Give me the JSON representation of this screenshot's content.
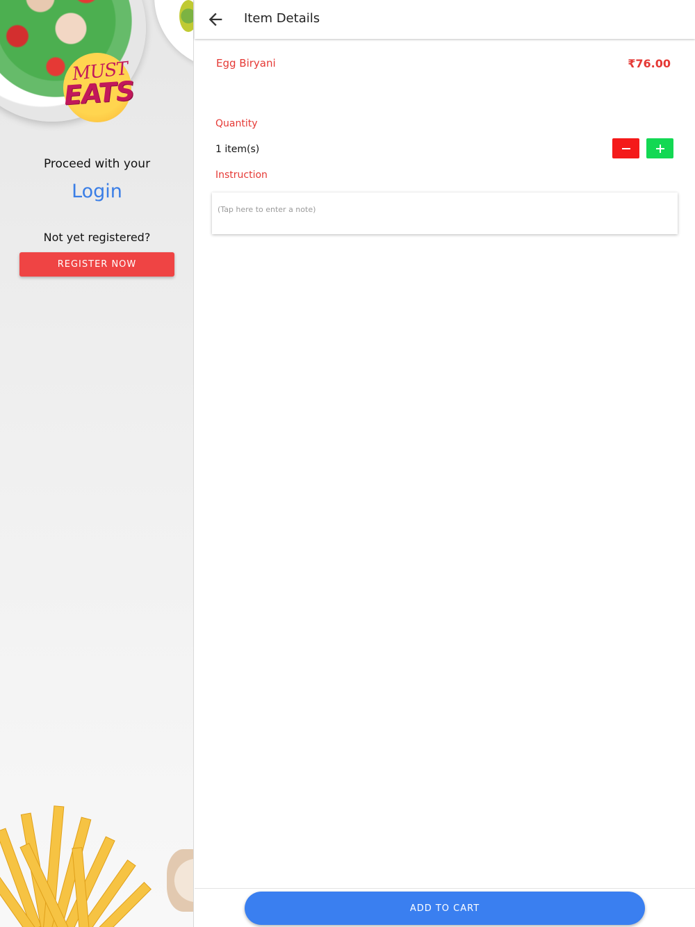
{
  "sidebar": {
    "logo_line1": "MUST",
    "logo_line2": "EATS",
    "proceed_text": "Proceed with your",
    "login_label": "Login",
    "not_registered_text": "Not yet registered?",
    "register_label": "REGISTER NOW"
  },
  "header": {
    "title": "Item Details",
    "back_icon": "arrow-left-icon"
  },
  "item": {
    "name": "Egg Biryani",
    "price": "₹76.00"
  },
  "quantity": {
    "label": "Quantity",
    "value": "1 item(s)",
    "decrement_icon": "minus-icon",
    "increment_icon": "plus-icon"
  },
  "instruction": {
    "label": "Instruction",
    "placeholder": "(Tap here to enter a note)",
    "value": ""
  },
  "footer": {
    "add_to_cart_label": "ADD TO CART"
  },
  "colors": {
    "accent_red": "#e53935",
    "primary_blue": "#3a7ff0",
    "minus_red": "#f41a1a",
    "plus_green": "#13d853"
  }
}
